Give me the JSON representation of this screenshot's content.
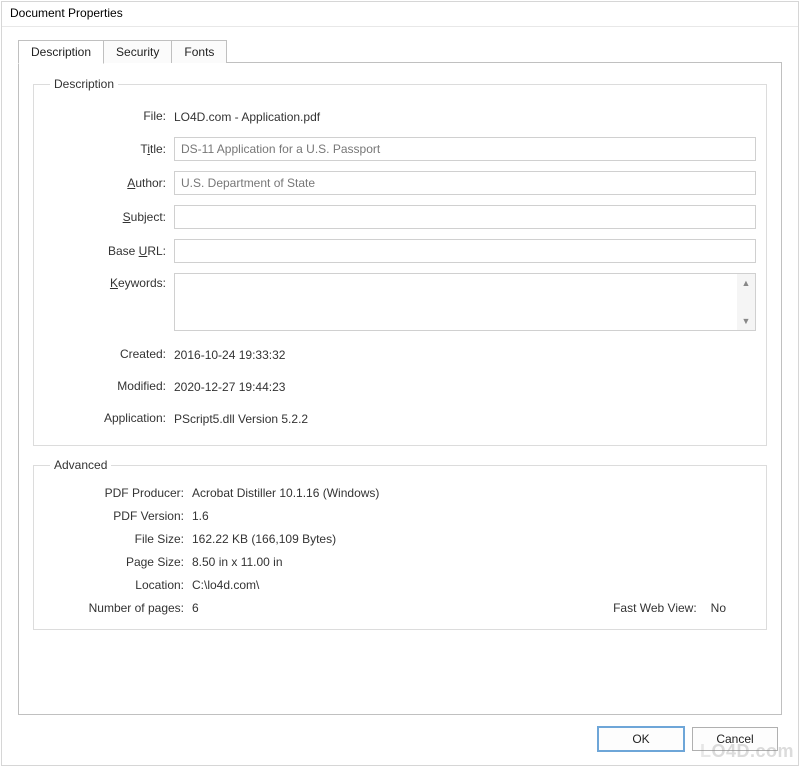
{
  "window": {
    "title": "Document Properties"
  },
  "tabs": {
    "description": "Description",
    "security": "Security",
    "fonts": "Fonts"
  },
  "description_group": {
    "legend": "Description",
    "labels": {
      "file": "File:",
      "title_pre": "T",
      "title_mn": "i",
      "title_post": "tle:",
      "author_mn": "A",
      "author_post": "uthor:",
      "subject_mn": "S",
      "subject_post": "ubject:",
      "baseurl_pre": "Base ",
      "baseurl_mn": "U",
      "baseurl_post": "RL:",
      "keywords_mn": "K",
      "keywords_post": "eywords:",
      "created": "Created:",
      "modified": "Modified:",
      "application": "Application:"
    },
    "values": {
      "file": "LO4D.com - Application.pdf",
      "title": "DS-11 Application for a U.S. Passport",
      "author": "U.S. Department of State",
      "subject": "",
      "base_url": "",
      "keywords": "",
      "created": "2016-10-24 19:33:32",
      "modified": "2020-12-27 19:44:23",
      "application": "PScript5.dll Version 5.2.2"
    }
  },
  "advanced_group": {
    "legend": "Advanced",
    "labels": {
      "producer": "PDF Producer:",
      "version": "PDF Version:",
      "filesize": "File Size:",
      "pagesize": "Page Size:",
      "location": "Location:",
      "pages": "Number of pages:",
      "fastweb": "Fast Web View:"
    },
    "values": {
      "producer": "Acrobat Distiller 10.1.16 (Windows)",
      "version": "1.6",
      "filesize": "162.22 KB (166,109 Bytes)",
      "pagesize": "8.50 in x 11.00 in",
      "location": "C:\\lo4d.com\\",
      "pages": "6",
      "fastweb": "No"
    }
  },
  "buttons": {
    "ok": "OK",
    "cancel": "Cancel"
  },
  "watermark": {
    "pre": "L",
    "main": "O4D.com"
  }
}
